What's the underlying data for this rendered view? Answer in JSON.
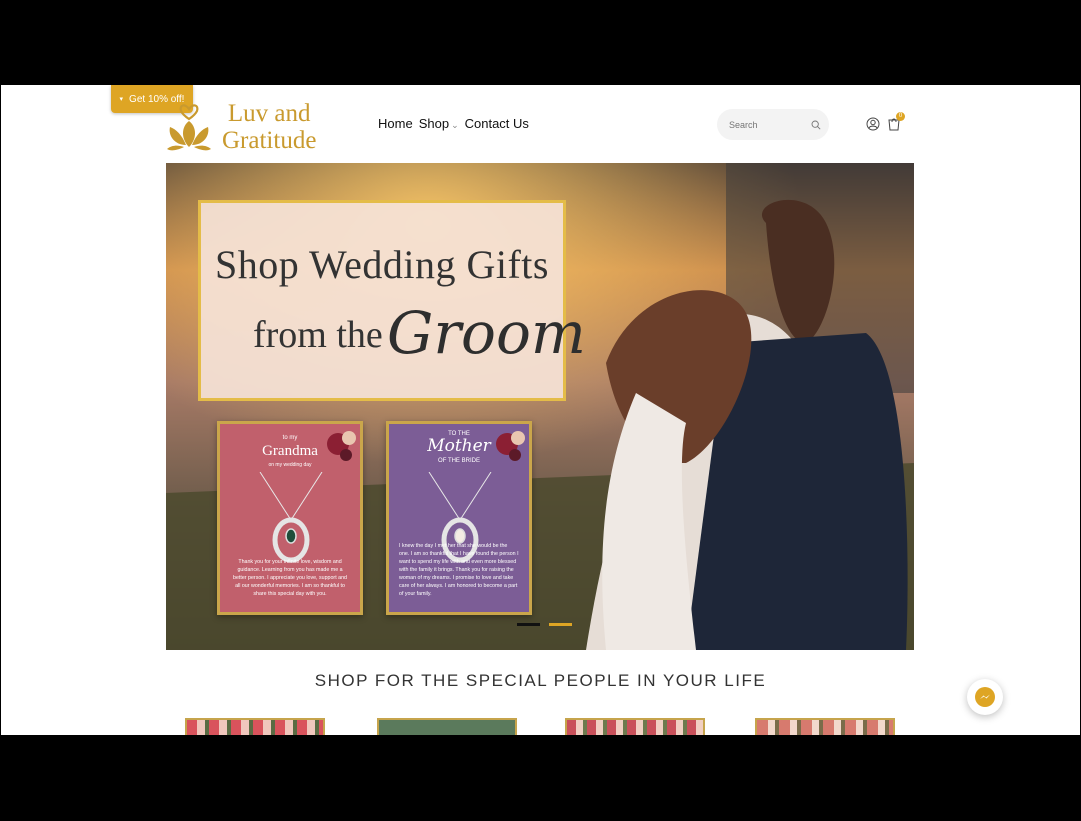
{
  "promo": {
    "label": "Get 10% off!",
    "arrow": "▾"
  },
  "brand": {
    "line1": "Luv and",
    "line2": "Gratitude",
    "logo_icon": "lotus-heart-icon",
    "color": "#c99a2e"
  },
  "nav": {
    "items": [
      {
        "label": "Home"
      },
      {
        "label": "Shop",
        "has_dropdown": true
      },
      {
        "label": "Contact Us"
      }
    ]
  },
  "search": {
    "placeholder": "Search",
    "icon": "search-icon"
  },
  "header_icons": {
    "account": "account-icon",
    "cart": "cart-icon",
    "cart_count": "0"
  },
  "hero": {
    "line1": "Shop Wedding Gifts",
    "line2": "from the",
    "line3": "Groom",
    "cards": [
      {
        "small": "to my",
        "title": "Grandma",
        "subtitle": "on my wedding day",
        "body": "Thank you for your infinite love, wisdom and guidance. Learning from you has made me a better person. I appreciate you love, support and all our wonderful memories. I am so thankful to share this special day with you."
      },
      {
        "small": "TO THE",
        "title": "Mother",
        "subtitle": "OF THE BRIDE",
        "body": "I knew the day I met her that she would be the one. I am so thankful that I have found the person I want to spend my life with and even more blessed with the family it brings. Thank you for raising the woman of my dreams. I promise to love and take care of her always. I am honored to become a part of your family."
      }
    ],
    "slides": 2,
    "active_slide": 2
  },
  "section": {
    "title": "SHOP FOR THE SPECIAL PEOPLE IN YOUR LIFE"
  },
  "products": [
    {},
    {},
    {},
    {}
  ],
  "colors": {
    "accent": "#dea524",
    "grandma_card": "#c1606c",
    "mother_card": "#7c5d96"
  },
  "chat": {
    "icon": "messenger-icon"
  }
}
